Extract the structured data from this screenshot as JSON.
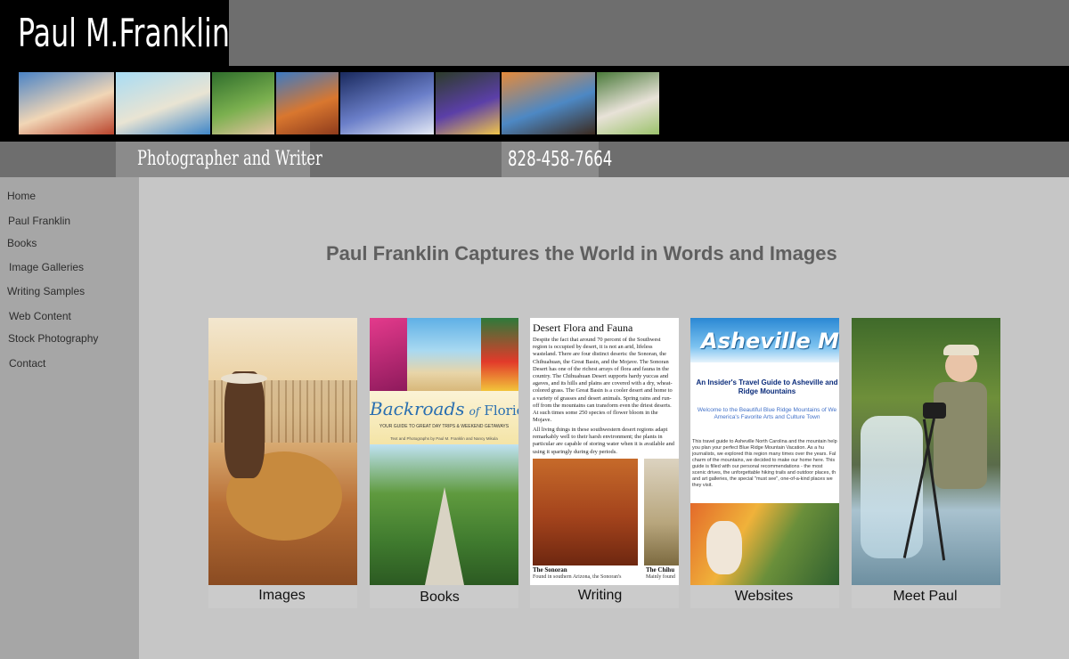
{
  "header": {
    "logo_text": "Paul M.Franklin",
    "tagline": "Photographer and Writer",
    "phone": "828-458-7664"
  },
  "banner_thumbnails": [
    {
      "name": "children-with-lobster",
      "colors": [
        "#4a83c6",
        "#f1d6b6",
        "#b9442c"
      ]
    },
    {
      "name": "sailboat-temple",
      "colors": [
        "#a8dcf4",
        "#e9e4d3",
        "#3f86c8"
      ]
    },
    {
      "name": "boy-with-dog",
      "colors": [
        "#2f6e2c",
        "#7bb04f",
        "#e4c2a0"
      ]
    },
    {
      "name": "delicate-arch",
      "colors": [
        "#3c7ac4",
        "#d9772f",
        "#8e3b1c"
      ]
    },
    {
      "name": "city-skyline",
      "colors": [
        "#1a2a5e",
        "#6b7fc9",
        "#e4e9f4"
      ]
    },
    {
      "name": "iris-flower",
      "colors": [
        "#2c3c2a",
        "#5b3fa8",
        "#f0c54a"
      ]
    },
    {
      "name": "coastal-sunset",
      "colors": [
        "#e68a3a",
        "#4d88c4",
        "#3b2a1f"
      ]
    },
    {
      "name": "white-tiger",
      "colors": [
        "#4a7a3a",
        "#e8e2d8",
        "#9bc26b"
      ]
    }
  ],
  "sidebar": {
    "items": [
      {
        "label": "Home"
      },
      {
        "label": "Paul Franklin"
      },
      {
        "label": "Books"
      },
      {
        "label": "Image Galleries"
      },
      {
        "label": "Writing Samples"
      },
      {
        "label": "Web Content"
      },
      {
        "label": "Stock Photography"
      },
      {
        "label": "Contact"
      }
    ]
  },
  "main": {
    "headline": "Paul Franklin Captures the World in Words and Images",
    "cards": [
      {
        "label": "Images"
      },
      {
        "label": "Books",
        "book_title_script": "Backroads",
        "book_title_of": "of",
        "book_title_place": "Florida",
        "book_subtitle": "YOUR GUIDE TO GREAT DAY TRIPS & WEEKEND GETAWAYS",
        "book_authors": "Text and Photographs by Paul M. Franklin and Nancy Mikula"
      },
      {
        "label": "Writing",
        "article_title": "Desert Flora and Fauna",
        "article_text": "Despite the fact that around 70 percent of the Southwest region is occupied by desert, it is not an arid, lifeless wasteland. There are four distinct deserts: the Sonoran, the Chihuahuan, the Great Basin, and the Mojave. The Sonoran Desert has one of the richest arrays of flora and fauna in the country. The Chihuahuan Desert supports hardy yuccas and agaves, and its hills and plains are covered with a dry, wheat-colored grass. The Great Basin is a cooler desert and home to a variety of grasses and desert animals. Spring rains and run-off from the mountains can transform even the driest deserts. At such times some 250 species of flower bloom in the Mojave.",
        "article_text2": "All living things in these southwestern desert regions adapt remarkably well to their harsh environment; the plants in particular are capable of storing water when it is available and using it sparingly during dry periods.",
        "photo_caption_1": "The Sonoran",
        "photo_text_1": "Found in southern Arizona, the Sonoran's",
        "photo_caption_2": "The Chihu",
        "photo_text_2": "Mainly found"
      },
      {
        "label": "Websites",
        "site_header": "Asheville Moun",
        "site_title": "An Insider's Travel Guide to Asheville and Ridge Mountains",
        "site_welcome": "Welcome to the Beautiful Blue Ridge Mountains of We America's Favorite Arts and Culture Town",
        "site_text": "This travel guide to Asheville North Carolina and the mountain help you plan your perfect Blue Ridge Mountain Vacation. As a hu journalists, we explored this region many times over the years. Fal charm of the mountains, we decided to make our home here. This guide is filled with our personal recommendations - the most scenic drives, the unforgettable hiking trails and outdoor places, th and art galleries, the special \"must see\", one-of-a-kind places we they visit."
      },
      {
        "label": "Meet Paul"
      }
    ]
  },
  "colors": {
    "page_bg": "#c6c6c6",
    "sidebar_bg": "#a6a6a6",
    "header_bg": "#6e6e6e",
    "logo_bg": "#000000",
    "headline": "#5f5f5f"
  }
}
